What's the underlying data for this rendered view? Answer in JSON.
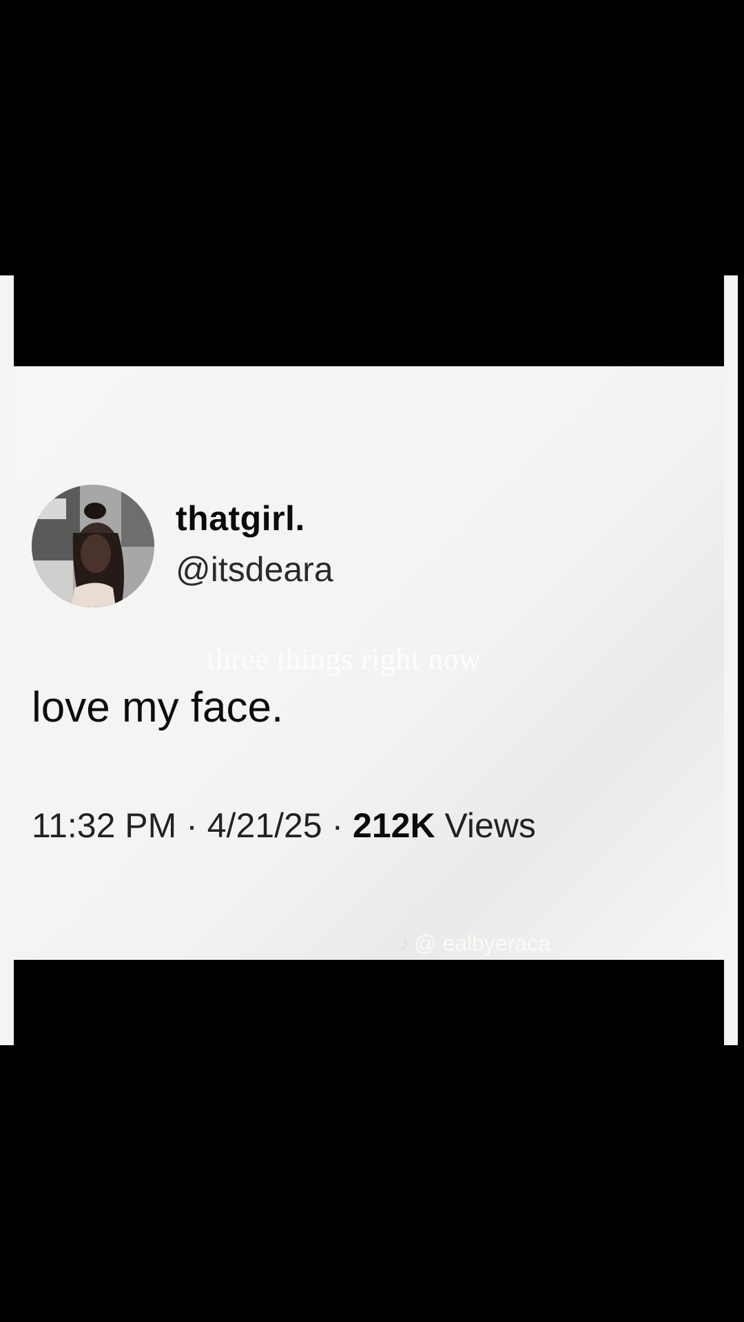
{
  "tweet": {
    "display_name": "thatgirl.",
    "handle": "@itsdeara",
    "text": "love my face.",
    "time": "11:32 PM",
    "separator": " · ",
    "date": "4/21/25",
    "views_count": "212K",
    "views_label": "Views"
  },
  "overlay": {
    "caption": "three things right now"
  },
  "watermark": {
    "icon": "tiktok-icon",
    "text": "@ ealbyeraca"
  },
  "colors": {
    "background": "#000000",
    "card": "#f5f5f3",
    "text": "#0b0b0b"
  }
}
